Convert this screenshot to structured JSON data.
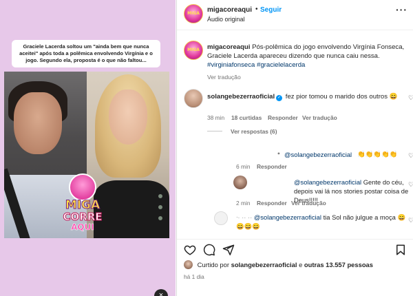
{
  "media": {
    "caption": "Graciele Lacerda soltou um \"ainda bem que nunca aceitei\" após toda a polêmica envolvendo Virgínia e o jogo. Segundo ela, proposta é o que não faltou...",
    "logo": {
      "line1": "MIGA",
      "line2": "CORRE",
      "line3": "AQUI"
    },
    "close_symbol": "×"
  },
  "header": {
    "username": "migacoreaqui",
    "separator": "•",
    "follow_label": "Seguir",
    "audio_label": "Áudio original",
    "more_label": "···"
  },
  "post": {
    "username": "migacoreaqui",
    "text": "Pós-polêmica do jogo envolvendo Virgínia Fonseca, Graciele Lacerda apareceu dizendo que nunca caiu nessa.",
    "hashtags": "#virginiafonseca #gracielelacerda",
    "see_translation": "Ver tradução"
  },
  "comment1": {
    "username": "solangebezerraoficial",
    "verified_mark": "✓",
    "text": "fez pior tomou o marido dos outros 😄",
    "time": "38 min",
    "likes": "18 curtidas",
    "reply_label": "Responder",
    "translate_label": "Ver tradução",
    "heart": "♡"
  },
  "replies_toggle": "Ver respostas (6)",
  "replies": [
    {
      "prefix": "ᐤ",
      "mention": "@solangebezerraoficial",
      "text": "👏👏👏👏👏",
      "time": "6 min",
      "reply_label": "Responder"
    },
    {
      "mention": "@solangebezerraoficial",
      "text": "Gente do céu, depois vai lá nos stories postar coisa de Deus!!!!!",
      "time": "2 min",
      "reply_label": "Responder",
      "translate_label": "Ver tradução"
    },
    {
      "prefix": "ᐧ· ·· ··",
      "mention": "@solangebezerraoficial",
      "text": "tia Sol não julgue a moça 😄😄😄😄"
    }
  ],
  "actions": {
    "like": "heart-icon",
    "comment": "comment-icon",
    "share": "share-icon",
    "save": "bookmark-icon"
  },
  "liked_by": {
    "prefix": "Curtido por",
    "user": "solangebezerraoficial",
    "joiner": "e",
    "others": "outras 13.557 pessoas"
  },
  "time_ago": "há 1 dia"
}
